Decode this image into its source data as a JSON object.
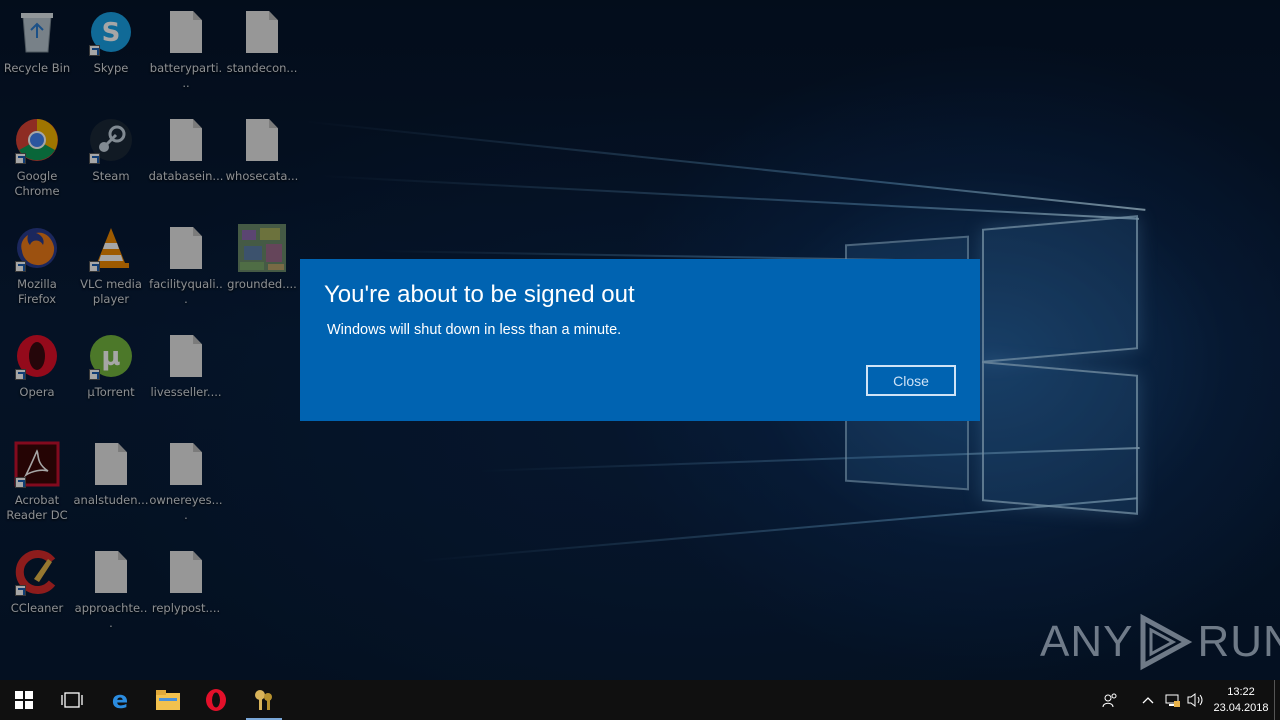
{
  "desktop": {
    "icons": [
      {
        "label": "Recycle Bin",
        "kind": "recycle-bin"
      },
      {
        "label": "Skype",
        "kind": "skype"
      },
      {
        "label": "batteryparti...",
        "kind": "document"
      },
      {
        "label": "standecon...",
        "kind": "document"
      },
      {
        "label": "Google Chrome",
        "kind": "chrome"
      },
      {
        "label": "Steam",
        "kind": "steam"
      },
      {
        "label": "databasein...",
        "kind": "document"
      },
      {
        "label": "whosecata...",
        "kind": "document"
      },
      {
        "label": "Mozilla Firefox",
        "kind": "firefox"
      },
      {
        "label": "VLC media player",
        "kind": "vlc"
      },
      {
        "label": "facilityquali...",
        "kind": "document"
      },
      {
        "label": "grounded....",
        "kind": "image-thumbnail"
      },
      {
        "label": "Opera",
        "kind": "opera"
      },
      {
        "label": "μTorrent",
        "kind": "utorrent"
      },
      {
        "label": "livesseller....",
        "kind": "document"
      },
      {
        "label": "Acrobat Reader DC",
        "kind": "acrobat"
      },
      {
        "label": "analstuden...",
        "kind": "document"
      },
      {
        "label": "ownereyes....",
        "kind": "document"
      },
      {
        "label": "CCleaner",
        "kind": "ccleaner"
      },
      {
        "label": "approachte...",
        "kind": "document"
      },
      {
        "label": "replypost....",
        "kind": "document"
      }
    ]
  },
  "dialog": {
    "title": "You're about to be signed out",
    "message": "Windows will shut down in less than a minute.",
    "close_label": "Close",
    "background": "#0063b1"
  },
  "watermark": {
    "left": "ANY",
    "right": "RUN"
  },
  "taskbar": {
    "items": [
      "start-icon",
      "task-view-icon",
      "edge-icon",
      "file-explorer-icon",
      "opera-icon",
      "keys-icon"
    ],
    "tray": [
      "people-icon",
      "chevron-up-icon",
      "network-icon",
      "volume-icon"
    ],
    "time": "13:22",
    "date": "23.04.2018"
  }
}
